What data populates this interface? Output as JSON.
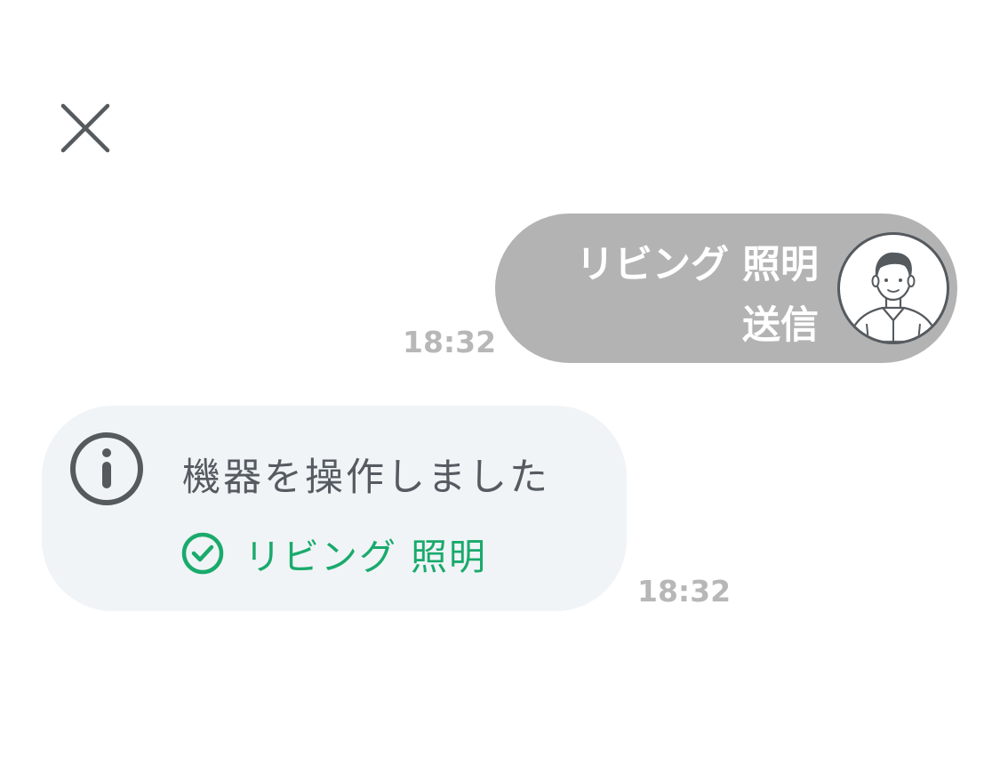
{
  "header": {
    "close_icon": "close-icon"
  },
  "sent_message": {
    "line1": "リビング 照明",
    "line2": "送信",
    "timestamp": "18:32",
    "avatar_icon": "user-avatar-icon"
  },
  "received_message": {
    "icon": "info-icon",
    "title": "機器を操作しました",
    "device_icon": "check-circle-icon",
    "device_label": "リビング 照明",
    "timestamp": "18:32"
  },
  "colors": {
    "sent_bubble": "#b3b3b3",
    "received_bubble": "#f0f4f7",
    "success_green": "#1aaa6c",
    "icon_gray": "#555a5f",
    "timestamp_gray": "#b7b7b7"
  }
}
